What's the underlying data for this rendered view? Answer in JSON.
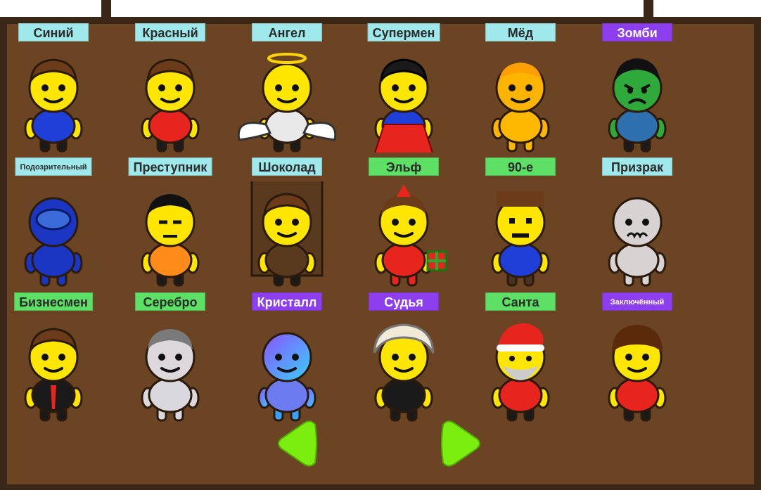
{
  "colors": {
    "board_frame": "#3a2718",
    "board_fill": "#6b4423",
    "tier_cyan": "#9fe9ec",
    "tier_green": "#5de065",
    "tier_purple": "#8d3ff0",
    "skin_yellow": "#ffe600",
    "arrow_green": "#7bed0f"
  },
  "skins": [
    {
      "name": "Синий",
      "tier": "cyan",
      "body": "#1f3fd8",
      "style": "basic"
    },
    {
      "name": "Красный",
      "tier": "cyan",
      "body": "#e8241f",
      "style": "basic"
    },
    {
      "name": "Ангел",
      "tier": "cyan",
      "body": "#e9e9e9",
      "style": "angel"
    },
    {
      "name": "Супермен",
      "tier": "cyan",
      "body": "#1f3fd8",
      "style": "super"
    },
    {
      "name": "Мёд",
      "tier": "cyan",
      "body": "#ffb800",
      "style": "honey"
    },
    {
      "name": "Зомби",
      "tier": "purple",
      "body": "#2e6fb0",
      "style": "zombie"
    },
    {
      "name": "Подозрительный",
      "tier": "cyan",
      "body": "#1c36c4",
      "style": "sus",
      "small": true
    },
    {
      "name": "Преступник",
      "tier": "cyan",
      "body": "#ff8c1a",
      "style": "criminal"
    },
    {
      "name": "Шоколад",
      "tier": "cyan",
      "body": "#5a3a1e",
      "style": "chocolate"
    },
    {
      "name": "Эльф",
      "tier": "green",
      "body": "#e8241f",
      "style": "elf"
    },
    {
      "name": "90-е",
      "tier": "green",
      "body": "#1f3fd8",
      "style": "pixel"
    },
    {
      "name": "Призрак",
      "tier": "cyan",
      "body": "#d9d2d2",
      "style": "ghost"
    },
    {
      "name": "Бизнесмен",
      "tier": "green",
      "body": "#1a1a1a",
      "style": "business"
    },
    {
      "name": "Серебро",
      "tier": "green",
      "body": "#d8d8de",
      "style": "silver"
    },
    {
      "name": "Кристалл",
      "tier": "purple",
      "body": "#6c7cf0",
      "style": "crystal"
    },
    {
      "name": "Судья",
      "tier": "purple",
      "body": "#1a1a1a",
      "style": "judge"
    },
    {
      "name": "Санта",
      "tier": "green",
      "body": "#e8241f",
      "style": "santa"
    },
    {
      "name": "Заключённый",
      "tier": "purple",
      "body": "#e8241f",
      "style": "prisoner",
      "small": true
    }
  ],
  "nav": {
    "prev_icon": "arrow-left-icon",
    "next_icon": "arrow-right-icon"
  }
}
